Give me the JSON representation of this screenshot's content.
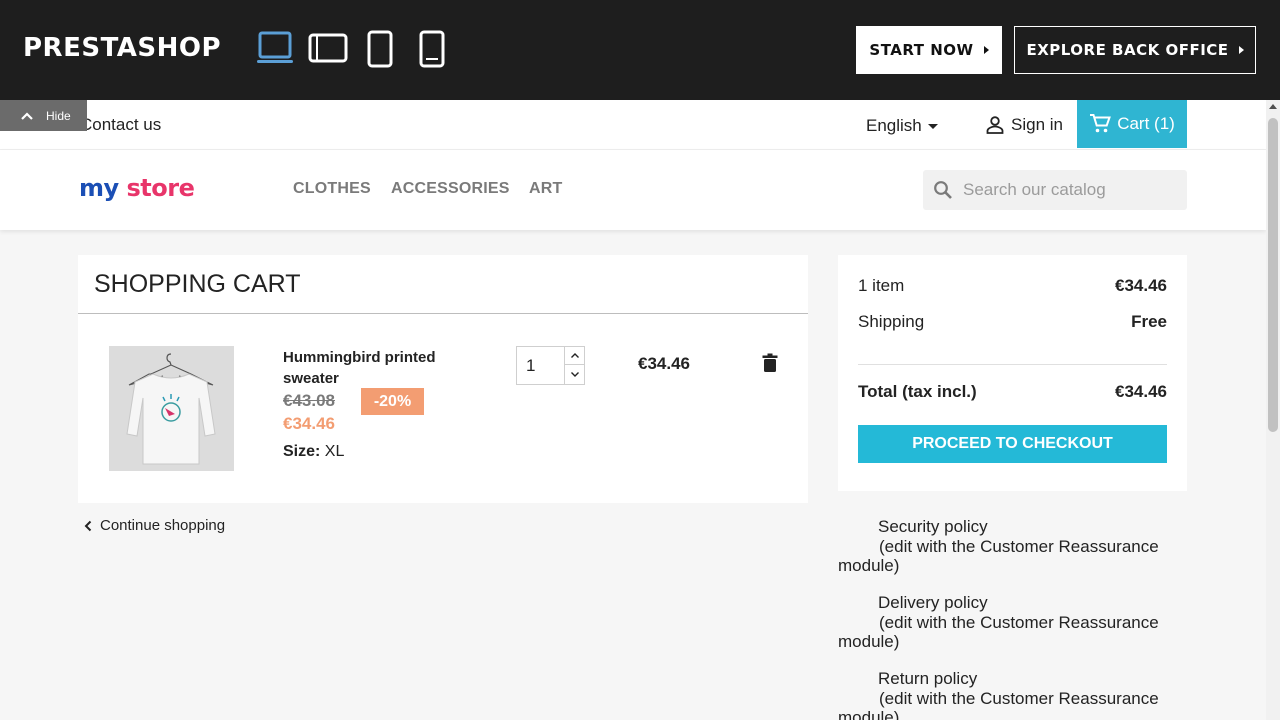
{
  "demo_bar": {
    "brand": "PRESTASHOP",
    "devices": [
      "laptop-icon",
      "tablet-landscape-icon",
      "tablet-portrait-icon",
      "phone-icon"
    ],
    "start_now": "START NOW",
    "explore": "EXPLORE BACK OFFICE",
    "hide": "Hide",
    "active_device_color": "#5b9fd6"
  },
  "header": {
    "contact": "Contact us",
    "language": "English",
    "sign_in": "Sign in",
    "cart": "Cart (1)",
    "cart_color": "#2fb5d2",
    "logo": {
      "part1": "my",
      "part2": "store"
    },
    "menu": [
      "CLOTHES",
      "ACCESSORIES",
      "ART"
    ],
    "search_placeholder": "Search our catalog"
  },
  "cart": {
    "title": "SHOPPING CART",
    "product": {
      "name": "Hummingbird printed sweater",
      "old_price": "€43.08",
      "discount": "-20%",
      "new_price": "€34.46",
      "size_label": "Size:",
      "size_value": "XL",
      "quantity": "1",
      "line_total": "€34.46"
    },
    "continue": "Continue shopping"
  },
  "summary": {
    "items_label": "1 item",
    "items_value": "€34.46",
    "shipping_label": "Shipping",
    "shipping_value": "Free",
    "total_label": "Total (tax incl.)",
    "total_value": "€34.46",
    "checkout": "PROCEED TO CHECKOUT",
    "checkout_color": "#24b9d7"
  },
  "reassurance": [
    {
      "title": "Security policy",
      "desc": "(edit with the Customer Reassurance module)"
    },
    {
      "title": "Delivery policy",
      "desc": "(edit with the Customer Reassurance module)"
    },
    {
      "title": "Return policy",
      "desc": "(edit with the Customer Reassurance module)"
    }
  ]
}
